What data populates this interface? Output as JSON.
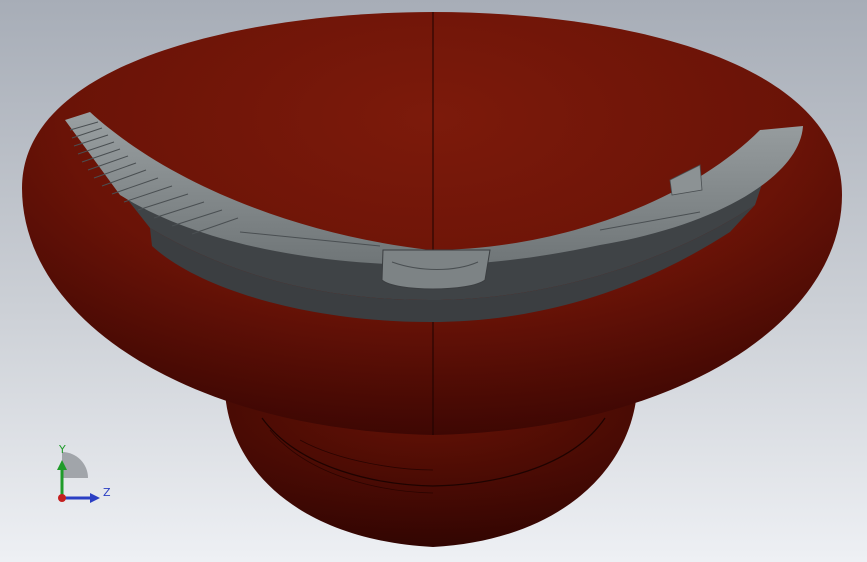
{
  "triad": {
    "y_label": "Y",
    "z_label": "Z",
    "y_icon": "y-axis-arrow-icon",
    "z_icon": "z-axis-arrow-icon",
    "x_icon": "x-axis-origin-icon"
  },
  "colors": {
    "background_top": "#a9aeb8",
    "background_bottom": "#eef0f4",
    "body_red": "#7a1a0c",
    "body_red_dark": "#3a0602",
    "cut_face": "#3c3f42",
    "cut_face_light": "#8a9092",
    "y_axis": "#1f9b2a",
    "z_axis": "#2b3fc4",
    "x_axis": "#c41f1f"
  }
}
